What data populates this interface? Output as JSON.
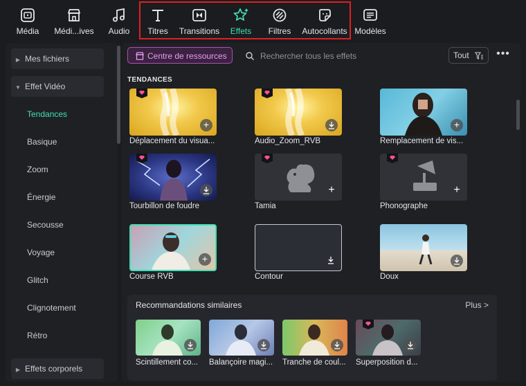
{
  "toolbar": {
    "tabs": [
      {
        "label": "Média",
        "icon": "media-icon"
      },
      {
        "label": "Médi...ives",
        "icon": "store-icon"
      },
      {
        "label": "Audio",
        "icon": "music-note-icon"
      },
      {
        "label": "Titres",
        "icon": "text-t-icon"
      },
      {
        "label": "Transitions",
        "icon": "transition-icon"
      },
      {
        "label": "Effets",
        "icon": "sparkle-star-icon"
      },
      {
        "label": "Filtres",
        "icon": "filter-icon"
      },
      {
        "label": "Autocollants",
        "icon": "sticker-icon"
      },
      {
        "label": "Modèles",
        "icon": "template-icon"
      }
    ],
    "active_tab": "Effets",
    "highlight_color": "#e02020"
  },
  "sidebar": {
    "items": [
      {
        "label": "Mes fichiers",
        "type": "group",
        "expanded": false
      },
      {
        "label": "Effet Vidéo",
        "type": "group",
        "expanded": true
      },
      {
        "label": "Tendances",
        "type": "sub",
        "active": true
      },
      {
        "label": "Basique",
        "type": "sub"
      },
      {
        "label": "Zoom",
        "type": "sub"
      },
      {
        "label": "Énergie",
        "type": "sub"
      },
      {
        "label": "Secousse",
        "type": "sub"
      },
      {
        "label": "Voyage",
        "type": "sub"
      },
      {
        "label": "Glitch",
        "type": "sub"
      },
      {
        "label": "Clignotement",
        "type": "sub"
      },
      {
        "label": "Rétro",
        "type": "sub"
      },
      {
        "label": "Effets corporels",
        "type": "group",
        "expanded": false
      }
    ]
  },
  "main": {
    "resource_button": "Centre de ressources",
    "search_placeholder": "Rechercher tous les effets",
    "filter_label": "Tout",
    "more_label": "•••",
    "section_title": "TENDANCES",
    "cards": [
      {
        "name": "Déplacement du visua...",
        "premium": true,
        "action": "add"
      },
      {
        "name": "Audio_Zoom_RVB",
        "premium": true,
        "action": "download"
      },
      {
        "name": "Remplacement de vis...",
        "premium": false,
        "action": "add"
      },
      {
        "name": "Tourbillon de foudre",
        "premium": true,
        "action": "download"
      },
      {
        "name": "Tamia",
        "premium": true,
        "action": "add"
      },
      {
        "name": "Phonographe",
        "premium": true,
        "action": "add"
      },
      {
        "name": "Course RVB",
        "premium": false,
        "action": "add"
      },
      {
        "name": "Contour",
        "premium": false,
        "action": "download"
      },
      {
        "name": "Doux",
        "premium": false,
        "action": "download"
      }
    ]
  },
  "recommendations": {
    "title": "Recommandations similaires",
    "more": "Plus >",
    "items": [
      {
        "name": "Scintillement co...",
        "premium": false
      },
      {
        "name": "Balançoire magi...",
        "premium": false
      },
      {
        "name": "Tranche de coul...",
        "premium": false
      },
      {
        "name": "Superposition d...",
        "premium": true
      }
    ]
  },
  "colors": {
    "accent": "#3fe0b5",
    "premium": "#ff4f9d",
    "resource": "#e89cf0"
  }
}
